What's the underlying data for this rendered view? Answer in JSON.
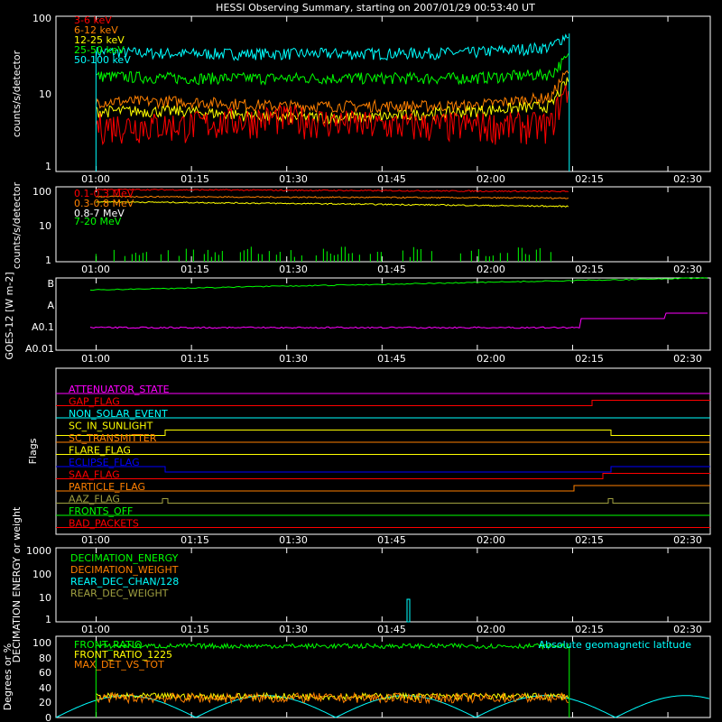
{
  "title": "HESSI Observing Summary, starting on 2007/01/29 00:53:40 UT",
  "time_ticks": [
    "01:00",
    "01:15",
    "01:30",
    "01:45",
    "02:00",
    "02:15",
    "02:30"
  ],
  "colors": {
    "red": "#ff0000",
    "orange": "#ff8000",
    "yellow": "#ffff00",
    "green": "#00ff00",
    "cyan": "#00ffff",
    "magenta": "#ff00ff",
    "blue": "#0000ff",
    "olive": "#a0a040",
    "white": "#ffffff"
  },
  "chart_data": [
    {
      "type": "line",
      "ylabel": "counts/s/detector",
      "yscale": "log",
      "ylim": [
        1,
        100
      ],
      "y_ticks": [
        "1",
        "10",
        "100"
      ],
      "x_unit": "minutes since 00:53:40 UT",
      "xlim": [
        0,
        103
      ],
      "series": [
        {
          "name": "3-6 keV",
          "color": "#ff0000",
          "x": [
            6.3,
            20,
            35,
            50,
            65,
            78,
            80.8
          ],
          "y": [
            4,
            4,
            5,
            4,
            4,
            4,
            12
          ]
        },
        {
          "name": "6-12 keV",
          "color": "#ff8000",
          "x": [
            6.3,
            20,
            35,
            50,
            65,
            78,
            80.8
          ],
          "y": [
            8,
            8,
            7,
            7,
            7,
            9,
            20
          ]
        },
        {
          "name": "12-25 keV",
          "color": "#ffff00",
          "x": [
            6.3,
            20,
            35,
            50,
            65,
            78,
            80.8
          ],
          "y": [
            6,
            6,
            5,
            5,
            6,
            7,
            15
          ]
        },
        {
          "name": "25-50 keV",
          "color": "#00ff00",
          "x": [
            6.3,
            20,
            35,
            50,
            65,
            78,
            80.8
          ],
          "y": [
            17,
            16,
            16,
            16,
            16,
            18,
            30
          ]
        },
        {
          "name": "50-100 keV",
          "color": "#00ffff",
          "x": [
            6.3,
            20,
            35,
            50,
            65,
            78,
            80.8
          ],
          "y": [
            35,
            33,
            33,
            33,
            34,
            40,
            60
          ]
        }
      ]
    },
    {
      "type": "line",
      "ylabel": "counts/s/detector",
      "yscale": "log",
      "ylim": [
        1,
        100
      ],
      "y_ticks": [
        "1",
        "10",
        "100"
      ],
      "series": [
        {
          "name": "0.1-0.3 MeV",
          "color": "#ff0000",
          "x": [
            6.3,
            80.8
          ],
          "y": [
            85,
            75
          ]
        },
        {
          "name": "0.3-0.8 MeV",
          "color": "#ff8000",
          "x": [
            6.3,
            80.8
          ],
          "y": [
            55,
            50
          ]
        },
        {
          "name": "0.8-7 MeV",
          "color": "#ffff00",
          "x": [
            6.3,
            80.8
          ],
          "y": [
            40,
            30
          ]
        },
        {
          "name": "7-20 MeV",
          "color": "#00ff00",
          "x": [
            6.3,
            80.8
          ],
          "y": [
            1.5,
            1.5
          ]
        }
      ]
    },
    {
      "type": "line",
      "ylabel": "GOES-12 [W m-2]",
      "y_ticks": [
        "A0.01",
        "A0.1",
        "A",
        "B"
      ],
      "series": [
        {
          "name": "",
          "color": "#00ff00",
          "level_desc": "low B",
          "x": [
            0,
            103
          ],
          "y": [
            0.8,
            1
          ]
        },
        {
          "name": "",
          "color": "#ff00ff",
          "level_desc": "A0.1 rising",
          "x": [
            0,
            103
          ],
          "y": [
            0.1,
            0.3
          ]
        }
      ]
    },
    {
      "type": "table",
      "ylabel": "Flags",
      "flags": [
        {
          "name": "ATTENUATOR_STATE",
          "color": "#ff00ff"
        },
        {
          "name": "GAP_FLAG",
          "color": "#ff0000"
        },
        {
          "name": "NON_SOLAR_EVENT",
          "color": "#00ffff"
        },
        {
          "name": "SC_IN_SUNLIGHT",
          "color": "#ffff00"
        },
        {
          "name": "SC_TRANSMITTER",
          "color": "#ff8000"
        },
        {
          "name": "FLARE_FLAG",
          "color": "#ffff00"
        },
        {
          "name": "ECLIPSE_FLAG",
          "color": "#0000ff"
        },
        {
          "name": "SAA_FLAG",
          "color": "#ff0000"
        },
        {
          "name": "PARTICLE_FLAG",
          "color": "#ff8000"
        },
        {
          "name": "AAZ_FLAG",
          "color": "#a0a040"
        },
        {
          "name": "FRONTS_OFF",
          "color": "#00ff00"
        },
        {
          "name": "BAD_PACKETS",
          "color": "#ff0000"
        }
      ]
    },
    {
      "type": "line",
      "ylabel": "DECIMATION ENERGY or weight",
      "yscale": "log",
      "ylim": [
        1,
        1000
      ],
      "y_ticks": [
        "1",
        "10",
        "100",
        "1000"
      ],
      "series": [
        {
          "name": "DECIMATION_ENERGY",
          "color": "#00ff00"
        },
        {
          "name": "DECIMATION_WEIGHT",
          "color": "#ff8000"
        },
        {
          "name": "REAR_DEC_CHAN/128",
          "color": "#00ffff"
        },
        {
          "name": "REAR_DEC_WEIGHT",
          "color": "#a0a040"
        }
      ]
    },
    {
      "type": "line",
      "ylabel": "Degrees or %",
      "ylim": [
        0,
        100
      ],
      "y_ticks": [
        "0",
        "20",
        "40",
        "60",
        "80",
        "100"
      ],
      "series": [
        {
          "name": "FRONT_RATIO",
          "color": "#00ff00"
        },
        {
          "name": "FRONT_RATIO_1225",
          "color": "#ffff00"
        },
        {
          "name": "MAX_DET_VS_TOT",
          "color": "#ff8000"
        },
        {
          "name": "Absolute geomagnetic latitude",
          "color": "#00ffff"
        }
      ]
    }
  ]
}
